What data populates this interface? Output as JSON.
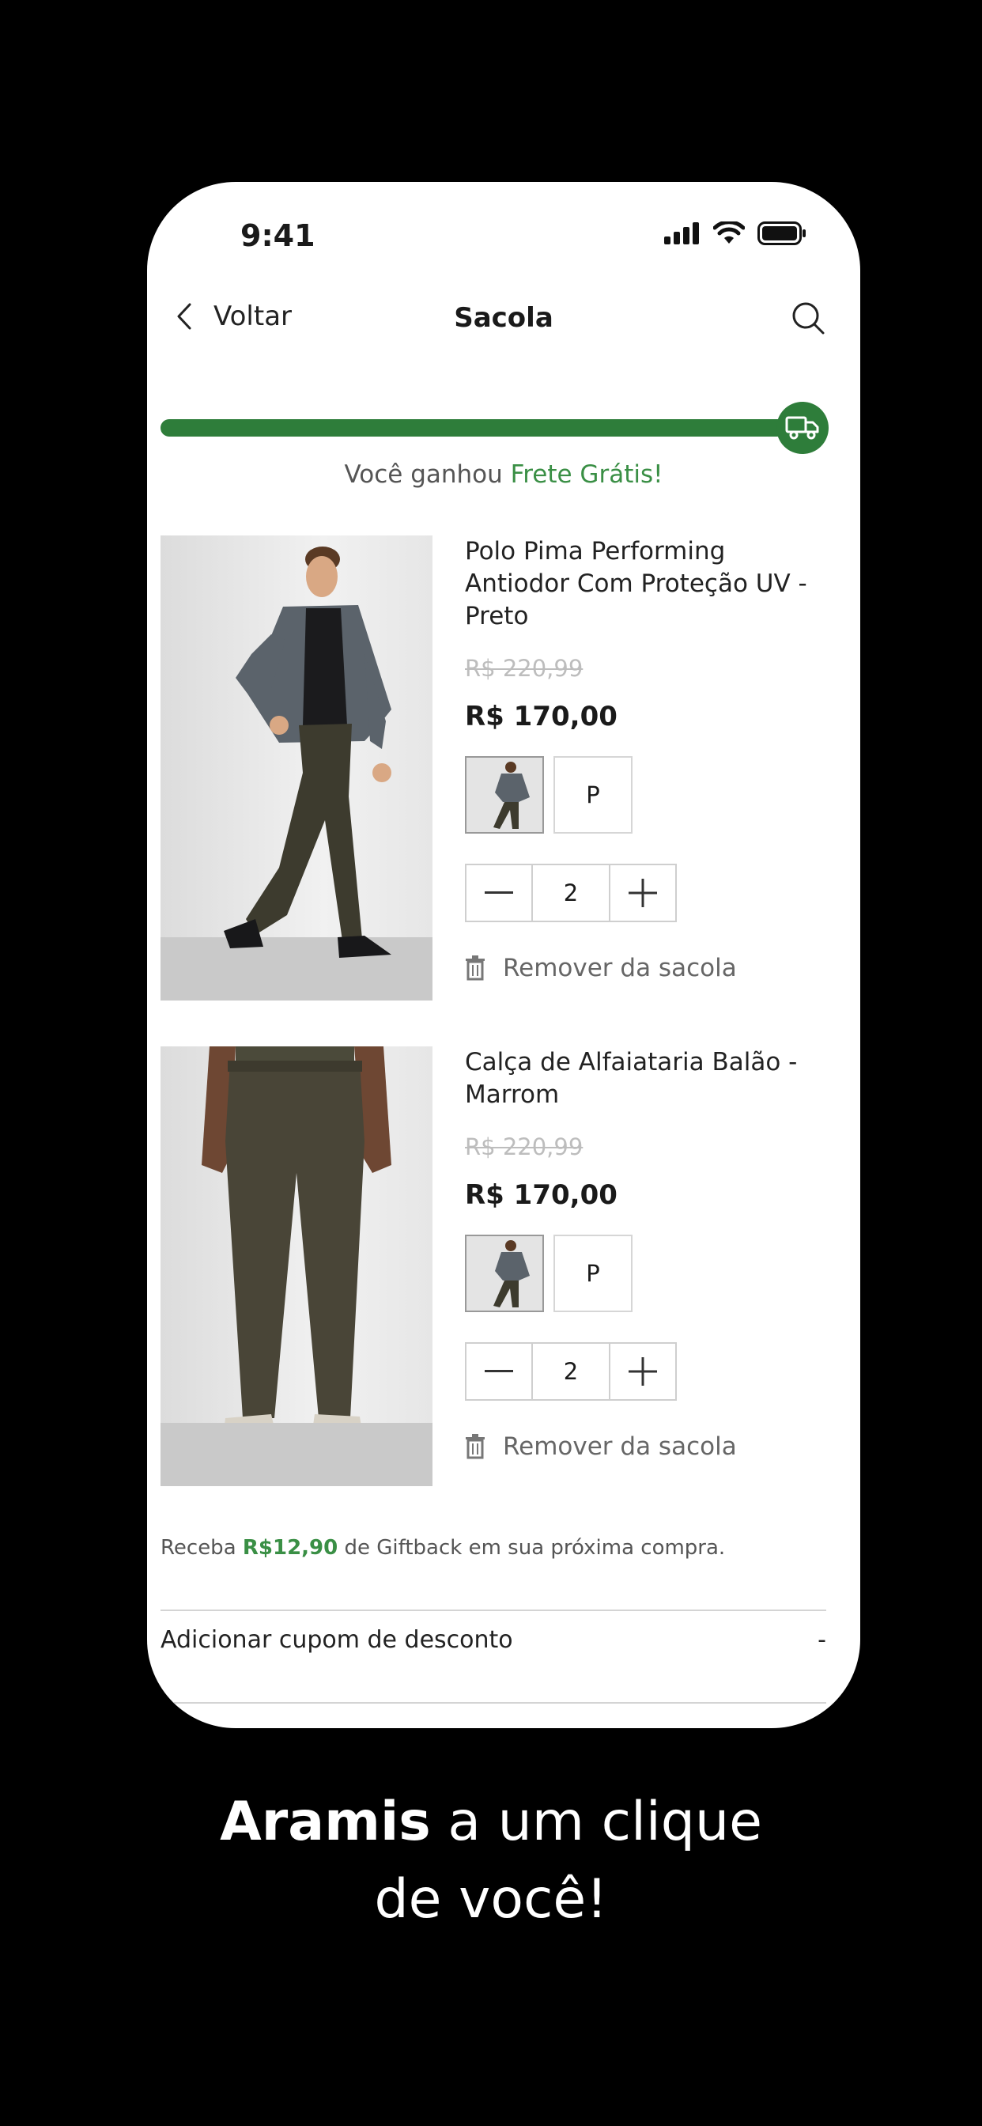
{
  "status_bar": {
    "time": "9:41"
  },
  "nav": {
    "back_label": "Voltar",
    "title": "Sacola"
  },
  "shipping": {
    "progress": 1.0,
    "message_prefix": "Você ganhou ",
    "message_highlight": "Frete Grátis!"
  },
  "products": [
    {
      "name": "Polo Pima Performing Antiodor Com Proteção UV - Preto",
      "old_price": "R$ 220,99",
      "price": "R$ 170,00",
      "size": "P",
      "quantity": "2",
      "remove_label": "Remover da sacola"
    },
    {
      "name": "Calça de Alfaiataria Balão - Marrom",
      "old_price": "R$ 220,99",
      "price": "R$ 170,00",
      "size": "P",
      "quantity": "2",
      "remove_label": "Remover da sacola"
    }
  ],
  "giftback": {
    "prefix": "Receba ",
    "amount": "R$12,90",
    "suffix": " de Giftback em sua próxima compra."
  },
  "coupon": {
    "label": "Adicionar cupom de desconto",
    "toggle": "-"
  },
  "tagline": {
    "brand": "Aramis",
    "line1_rest": " a um clique",
    "line2": "de você!"
  },
  "colors": {
    "accent_green": "#2e7d3a",
    "background": "#000000",
    "card": "#ffffff"
  },
  "icons": [
    "chevron-left-icon",
    "search-icon",
    "truck-icon",
    "minus-icon",
    "plus-icon",
    "trash-icon",
    "signal-icon",
    "wifi-icon",
    "battery-icon"
  ]
}
